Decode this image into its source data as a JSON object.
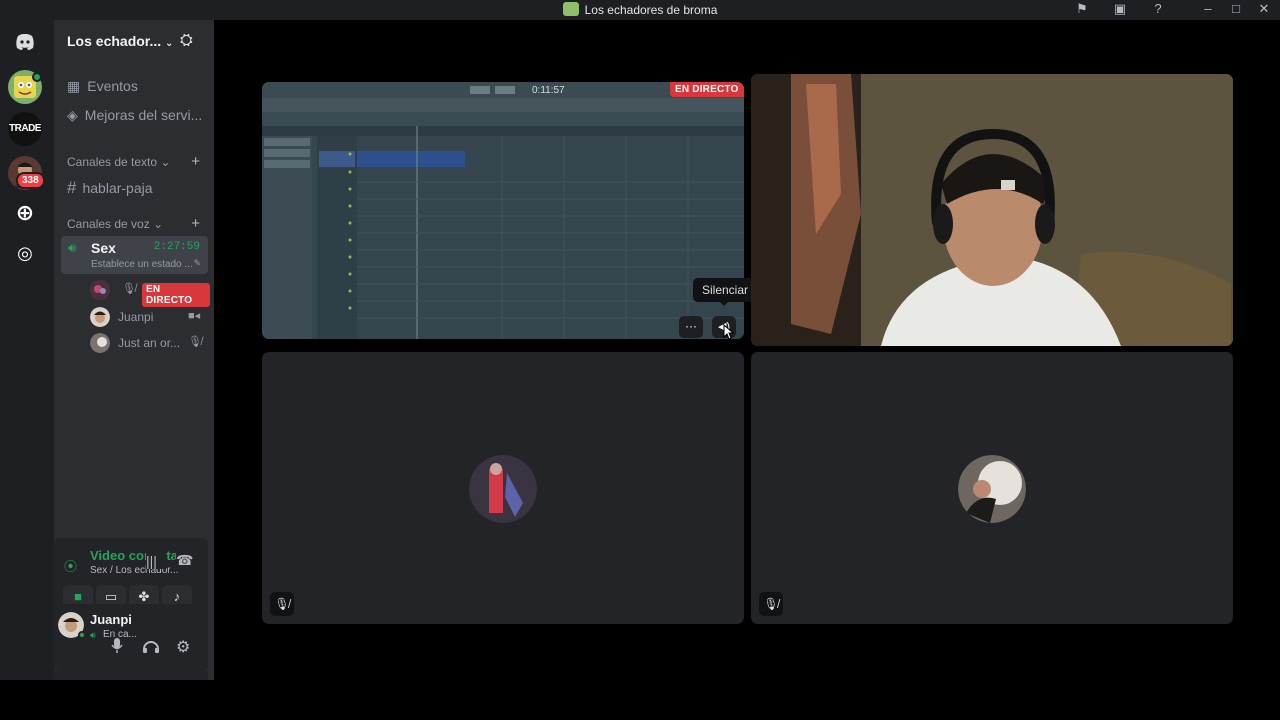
{
  "window": {
    "title": "Los echadores de broma"
  },
  "server": {
    "name": "Los echador...",
    "guild_badge_count": "338",
    "guild_trade_label": "TRADE"
  },
  "sidebar": {
    "events_label": "Eventos",
    "boosts_label": "Mejoras del servi...",
    "text_category": "Canales de texto",
    "text_channel": "hablar-paja",
    "voice_category": "Canales de voz",
    "voice_channel": {
      "name": "Sex",
      "timer": "2:27:59",
      "status": "Establece un estado ..."
    },
    "voice_users": [
      {
        "name": "",
        "badge": "EN DIRECTO"
      },
      {
        "name": "Juanpi"
      },
      {
        "name": "Just an or..."
      }
    ]
  },
  "voice_panel": {
    "status": "Video conectad",
    "location": "Sex / Los echador..."
  },
  "user_panel": {
    "username": "Juanpi",
    "status": "En ca..."
  },
  "stage": {
    "live_badge": "EN DIRECTO",
    "tooltip": "Silenciar",
    "stream_time": "0:11:57"
  },
  "colors": {
    "accent_green": "#23a55a",
    "live_red": "#da373c",
    "sidebar_bg": "#2b2d31",
    "guild_bg": "#1e1f22"
  }
}
